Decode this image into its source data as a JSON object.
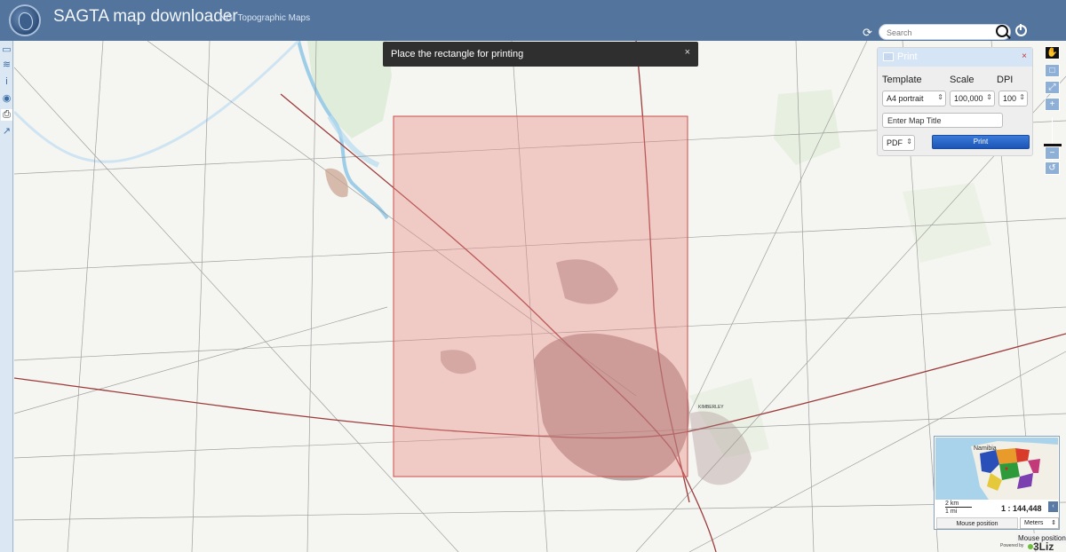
{
  "header": {
    "title": "SAGTA map downloader",
    "subtitle": "NGI Topographic Maps",
    "search_placeholder": "Search"
  },
  "left_toolbar": {
    "items": [
      "folder-icon",
      "layers-icon",
      "info-icon",
      "locate-icon",
      "print-icon",
      "share-icon"
    ],
    "active": "print-icon"
  },
  "toast": {
    "message": "Place the rectangle for printing",
    "close": "×"
  },
  "print_panel": {
    "title": "Print",
    "close": "×",
    "template_label": "Template",
    "scale_label": "Scale",
    "dpi_label": "DPI",
    "template_value": "A4 portrait",
    "scale_value": "100,000",
    "dpi_value": "100",
    "map_title_placeholder": "Enter Map Title",
    "format_value": "PDF",
    "print_button": "Print"
  },
  "map": {
    "place_labels": [
      "KIMBERLEY"
    ]
  },
  "overview": {
    "country_label": "Namibia",
    "scale_km": "2 km",
    "scale_mi": "1 mi",
    "scale_ratio": "1 : 144,448",
    "mouse_position_label": "Mouse position",
    "units": "Meters"
  },
  "footer": {
    "mouse_position_tip": "Mouse position",
    "powered_by": "Powered by",
    "brand": "3Liz"
  },
  "colors": {
    "header": "#52749d",
    "print_rectangle": "#e88a85",
    "print_button": "#1d55b5"
  }
}
